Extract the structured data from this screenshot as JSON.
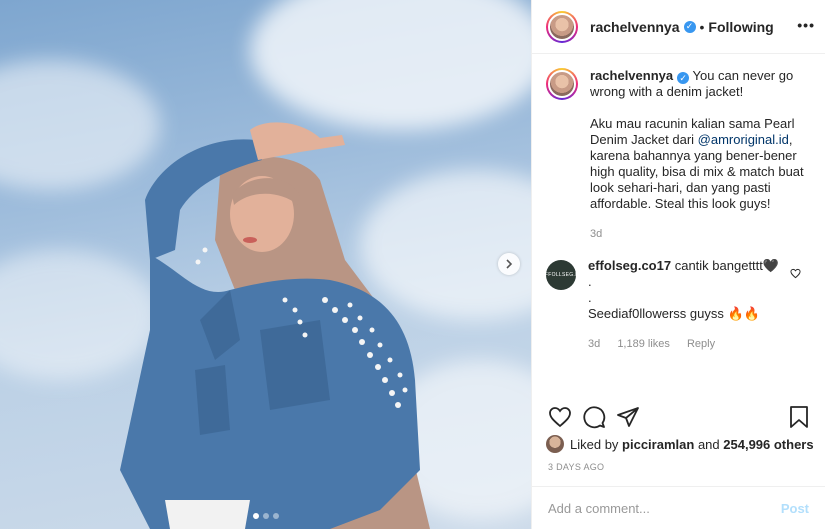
{
  "post": {
    "username": "rachelvennya",
    "follow_status": "Following",
    "separator": "•",
    "more_icon": "more-horizontal-icon"
  },
  "caption": {
    "username": "rachelvennya",
    "line1": "You can never go wrong with a denim jacket!",
    "body_before_link": "Aku mau racunin kalian sama Pearl Denim Jacket dari ",
    "mention": "@amroriginal.id",
    "body_after_link": ", karena bahannya yang bener-bener high quality, bisa di mix & match buat look sehari-hari, dan yang pasti affordable. Steal this look guys!",
    "time": "3d"
  },
  "comment": {
    "username": "effolseg.co17",
    "text1": "cantik bangetttt🖤",
    "dot1": ".",
    "dot2": ".",
    "text2": "Seediaf0llowerss guyss 🔥🔥",
    "time": "3d",
    "likes": "1,189 likes",
    "reply": "Reply",
    "avatar_text": "EFFOLLSEG.ID"
  },
  "likes": {
    "prefix": "Liked by ",
    "user": "picciramlan",
    "middle": " and ",
    "count": "254,996 others"
  },
  "date": "3 DAYS AGO",
  "add_comment": {
    "placeholder": "Add a comment...",
    "post_label": "Post"
  },
  "colors": {
    "verified": "#3897f0",
    "link": "#003569",
    "post_button_disabled": "#b2dffc"
  }
}
